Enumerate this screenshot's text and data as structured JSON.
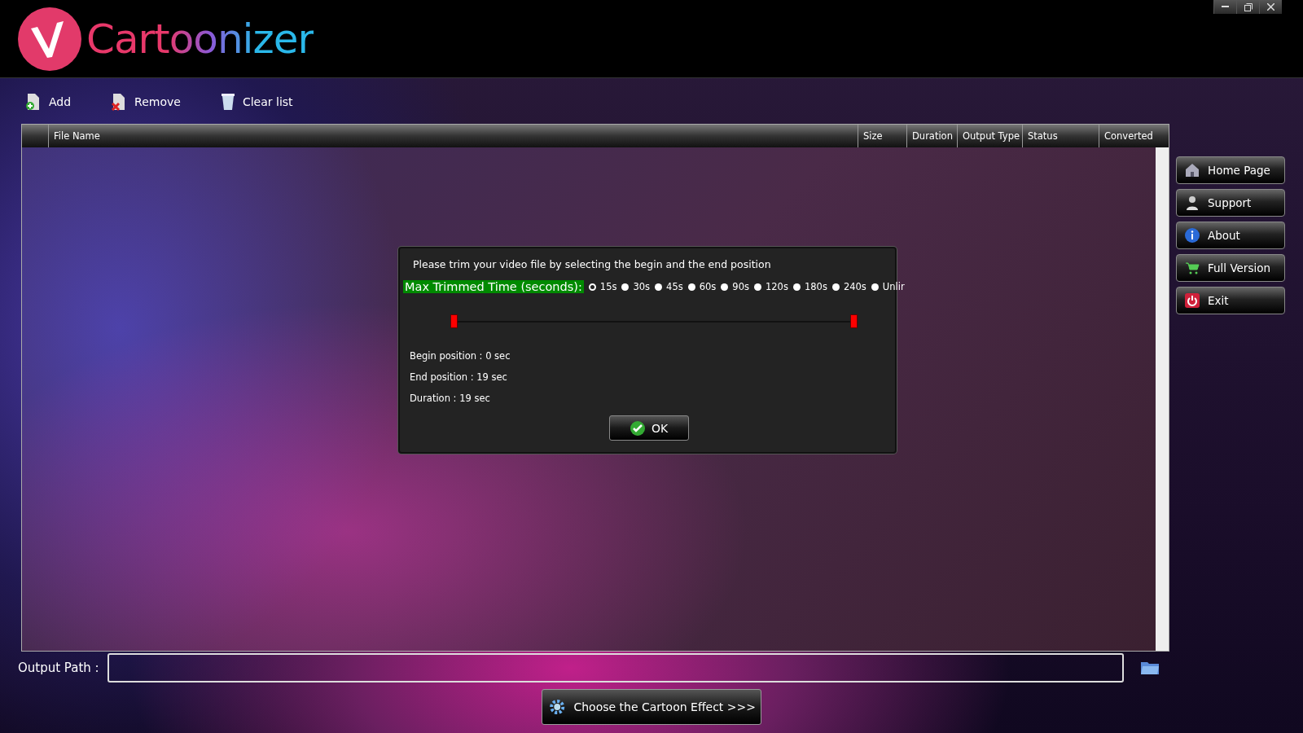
{
  "logo": {
    "text": "Cartoonizer"
  },
  "window_controls": [
    {
      "kind": "minimize"
    },
    {
      "kind": "restore"
    },
    {
      "kind": "close"
    }
  ],
  "toolbar": [
    {
      "kind": "add",
      "label": "Add"
    },
    {
      "kind": "remove",
      "label": "Remove"
    },
    {
      "kind": "clear",
      "label": "Clear list"
    }
  ],
  "table": {
    "columns": [
      "File Name",
      "Size",
      "Duration",
      "Output Type",
      "Status",
      "Converted"
    ]
  },
  "sidebar": [
    {
      "kind": "home",
      "label": "Home Page"
    },
    {
      "kind": "support",
      "label": "Support"
    },
    {
      "kind": "about",
      "label": "About"
    },
    {
      "kind": "cart",
      "label": "Full Version"
    },
    {
      "kind": "exit",
      "label": "Exit"
    }
  ],
  "dialog": {
    "instruction": "Please trim your video file by selecting the begin and the end position",
    "max_label": "Max Trimmed Time (seconds):",
    "options": [
      {
        "label": "15s",
        "selected": true
      },
      {
        "label": "30s",
        "selected": false
      },
      {
        "label": "45s",
        "selected": false
      },
      {
        "label": "60s",
        "selected": false
      },
      {
        "label": "90s",
        "selected": false
      },
      {
        "label": "120s",
        "selected": false
      },
      {
        "label": "180s",
        "selected": false
      },
      {
        "label": "240s",
        "selected": false
      },
      {
        "label": "Unlir",
        "selected": false
      }
    ],
    "thumbs": [
      {
        "level": 0
      },
      {
        "level": 1
      }
    ],
    "begin": "Begin position : 0 sec",
    "end": "End position : 19 sec",
    "duration": "Duration : 19 sec",
    "ok": "OK"
  },
  "output": {
    "label": "Output Path :"
  },
  "convert_button": "Choose the Cartoon Effect >>>"
}
